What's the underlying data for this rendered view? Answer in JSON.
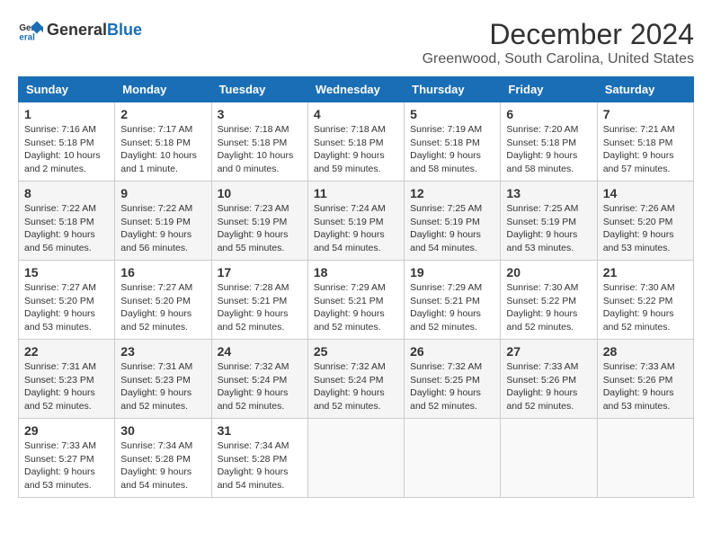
{
  "header": {
    "logo_line1": "General",
    "logo_line2": "Blue",
    "month_title": "December 2024",
    "location": "Greenwood, South Carolina, United States"
  },
  "days_of_week": [
    "Sunday",
    "Monday",
    "Tuesday",
    "Wednesday",
    "Thursday",
    "Friday",
    "Saturday"
  ],
  "weeks": [
    [
      {
        "day": "1",
        "info": "Sunrise: 7:16 AM\nSunset: 5:18 PM\nDaylight: 10 hours\nand 2 minutes."
      },
      {
        "day": "2",
        "info": "Sunrise: 7:17 AM\nSunset: 5:18 PM\nDaylight: 10 hours\nand 1 minute."
      },
      {
        "day": "3",
        "info": "Sunrise: 7:18 AM\nSunset: 5:18 PM\nDaylight: 10 hours\nand 0 minutes."
      },
      {
        "day": "4",
        "info": "Sunrise: 7:18 AM\nSunset: 5:18 PM\nDaylight: 9 hours\nand 59 minutes."
      },
      {
        "day": "5",
        "info": "Sunrise: 7:19 AM\nSunset: 5:18 PM\nDaylight: 9 hours\nand 58 minutes."
      },
      {
        "day": "6",
        "info": "Sunrise: 7:20 AM\nSunset: 5:18 PM\nDaylight: 9 hours\nand 58 minutes."
      },
      {
        "day": "7",
        "info": "Sunrise: 7:21 AM\nSunset: 5:18 PM\nDaylight: 9 hours\nand 57 minutes."
      }
    ],
    [
      {
        "day": "8",
        "info": "Sunrise: 7:22 AM\nSunset: 5:18 PM\nDaylight: 9 hours\nand 56 minutes."
      },
      {
        "day": "9",
        "info": "Sunrise: 7:22 AM\nSunset: 5:19 PM\nDaylight: 9 hours\nand 56 minutes."
      },
      {
        "day": "10",
        "info": "Sunrise: 7:23 AM\nSunset: 5:19 PM\nDaylight: 9 hours\nand 55 minutes."
      },
      {
        "day": "11",
        "info": "Sunrise: 7:24 AM\nSunset: 5:19 PM\nDaylight: 9 hours\nand 54 minutes."
      },
      {
        "day": "12",
        "info": "Sunrise: 7:25 AM\nSunset: 5:19 PM\nDaylight: 9 hours\nand 54 minutes."
      },
      {
        "day": "13",
        "info": "Sunrise: 7:25 AM\nSunset: 5:19 PM\nDaylight: 9 hours\nand 53 minutes."
      },
      {
        "day": "14",
        "info": "Sunrise: 7:26 AM\nSunset: 5:20 PM\nDaylight: 9 hours\nand 53 minutes."
      }
    ],
    [
      {
        "day": "15",
        "info": "Sunrise: 7:27 AM\nSunset: 5:20 PM\nDaylight: 9 hours\nand 53 minutes."
      },
      {
        "day": "16",
        "info": "Sunrise: 7:27 AM\nSunset: 5:20 PM\nDaylight: 9 hours\nand 52 minutes."
      },
      {
        "day": "17",
        "info": "Sunrise: 7:28 AM\nSunset: 5:21 PM\nDaylight: 9 hours\nand 52 minutes."
      },
      {
        "day": "18",
        "info": "Sunrise: 7:29 AM\nSunset: 5:21 PM\nDaylight: 9 hours\nand 52 minutes."
      },
      {
        "day": "19",
        "info": "Sunrise: 7:29 AM\nSunset: 5:21 PM\nDaylight: 9 hours\nand 52 minutes."
      },
      {
        "day": "20",
        "info": "Sunrise: 7:30 AM\nSunset: 5:22 PM\nDaylight: 9 hours\nand 52 minutes."
      },
      {
        "day": "21",
        "info": "Sunrise: 7:30 AM\nSunset: 5:22 PM\nDaylight: 9 hours\nand 52 minutes."
      }
    ],
    [
      {
        "day": "22",
        "info": "Sunrise: 7:31 AM\nSunset: 5:23 PM\nDaylight: 9 hours\nand 52 minutes."
      },
      {
        "day": "23",
        "info": "Sunrise: 7:31 AM\nSunset: 5:23 PM\nDaylight: 9 hours\nand 52 minutes."
      },
      {
        "day": "24",
        "info": "Sunrise: 7:32 AM\nSunset: 5:24 PM\nDaylight: 9 hours\nand 52 minutes."
      },
      {
        "day": "25",
        "info": "Sunrise: 7:32 AM\nSunset: 5:24 PM\nDaylight: 9 hours\nand 52 minutes."
      },
      {
        "day": "26",
        "info": "Sunrise: 7:32 AM\nSunset: 5:25 PM\nDaylight: 9 hours\nand 52 minutes."
      },
      {
        "day": "27",
        "info": "Sunrise: 7:33 AM\nSunset: 5:26 PM\nDaylight: 9 hours\nand 52 minutes."
      },
      {
        "day": "28",
        "info": "Sunrise: 7:33 AM\nSunset: 5:26 PM\nDaylight: 9 hours\nand 53 minutes."
      }
    ],
    [
      {
        "day": "29",
        "info": "Sunrise: 7:33 AM\nSunset: 5:27 PM\nDaylight: 9 hours\nand 53 minutes."
      },
      {
        "day": "30",
        "info": "Sunrise: 7:34 AM\nSunset: 5:28 PM\nDaylight: 9 hours\nand 54 minutes."
      },
      {
        "day": "31",
        "info": "Sunrise: 7:34 AM\nSunset: 5:28 PM\nDaylight: 9 hours\nand 54 minutes."
      },
      {
        "day": "",
        "info": ""
      },
      {
        "day": "",
        "info": ""
      },
      {
        "day": "",
        "info": ""
      },
      {
        "day": "",
        "info": ""
      }
    ]
  ]
}
